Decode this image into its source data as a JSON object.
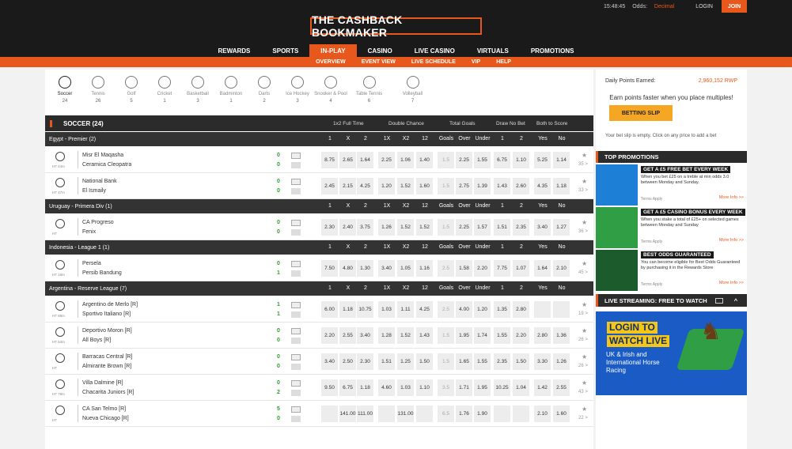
{
  "topbar": {
    "time": "15:48:45",
    "odds_label": "Odds:",
    "odds_value": "Decimal",
    "login": "LOGIN",
    "join": "JOIN"
  },
  "brand": {
    "logo": "THE CASHBACK BOOKMAKER",
    "accent": "#e8581c"
  },
  "nav": [
    "REWARDS",
    "SPORTS",
    "IN-PLAY",
    "CASINO",
    "LIVE CASINO",
    "VIRTUALS",
    "PROMOTIONS"
  ],
  "subnav": [
    "OVERVIEW",
    "EVENT VIEW",
    "LIVE SCHEDULE",
    "VIP",
    "HELP"
  ],
  "sports": [
    {
      "name": "Soccer",
      "count": "24",
      "icon": "soccer-icon"
    },
    {
      "name": "Tennis",
      "count": "26",
      "icon": "tennis-icon"
    },
    {
      "name": "Golf",
      "count": "5",
      "icon": "golf-icon"
    },
    {
      "name": "Cricket",
      "count": "1",
      "icon": "cricket-icon"
    },
    {
      "name": "Basketball",
      "count": "3",
      "icon": "basketball-icon"
    },
    {
      "name": "Badminton",
      "count": "1",
      "icon": "badminton-icon"
    },
    {
      "name": "Darts",
      "count": "2",
      "icon": "darts-icon"
    },
    {
      "name": "Ice Hockey",
      "count": "3",
      "icon": "ice-hockey-icon"
    },
    {
      "name": "Snooker & Pool",
      "count": "4",
      "icon": "snooker-icon"
    },
    {
      "name": "Table Tennis",
      "count": "6",
      "icon": "table-tennis-icon"
    },
    {
      "name": "Volleyball",
      "count": "7",
      "icon": "volleyball-icon"
    }
  ],
  "section": {
    "title": "SOCCER (24)",
    "groups": [
      "1x2 Full Time",
      "Double Chance",
      "Total Goals",
      "Draw No Bet",
      "Both to Score"
    ]
  },
  "market_cols": [
    "1",
    "X",
    "2",
    "1X",
    "X2",
    "12",
    "Goals",
    "Over",
    "Under",
    "1",
    "2",
    "Yes",
    "No"
  ],
  "leagues": [
    {
      "name": "Egypt - Premier (2)",
      "matches": [
        {
          "time": "HT 44m",
          "home": "Misr El Maqasha",
          "away": "Ceramica Cleopatra",
          "s1": "0",
          "s2": "0",
          "odds": [
            "8.75",
            "2.65",
            "1.64",
            "2.25",
            "1.06",
            "1.40",
            "1.5",
            "2.25",
            "1.55",
            "6.75",
            "1.10",
            "5.25",
            "1.14"
          ],
          "more": "35"
        },
        {
          "time": "HT 47m",
          "home": "National Bank",
          "away": "El Ismaily",
          "s1": "0",
          "s2": "0",
          "odds": [
            "2.45",
            "2.15",
            "4.25",
            "1.20",
            "1.52",
            "1.60",
            "1.5",
            "2.75",
            "1.39",
            "1.43",
            "2.60",
            "4.35",
            "1.18"
          ],
          "more": "33"
        }
      ]
    },
    {
      "name": "Uruguay - Primera Div (1)",
      "matches": [
        {
          "time": "HT",
          "home": "CA Progreso",
          "away": "Fenix",
          "s1": "0",
          "s2": "0",
          "odds": [
            "2.30",
            "2.40",
            "3.75",
            "1.26",
            "1.52",
            "1.52",
            "1.5",
            "2.25",
            "1.57",
            "1.51",
            "2.35",
            "3.40",
            "1.27"
          ],
          "more": "36"
        }
      ]
    },
    {
      "name": "Indonesia - League 1 (1)",
      "matches": [
        {
          "time": "HT 18m",
          "home": "Persela",
          "away": "Persib Bandung",
          "s1": "0",
          "s2": "1",
          "odds": [
            "7.50",
            "4.80",
            "1.30",
            "3.40",
            "1.05",
            "1.16",
            "2.5",
            "1.58",
            "2.20",
            "7.75",
            "1.07",
            "1.64",
            "2.10"
          ],
          "more": "45"
        }
      ]
    },
    {
      "name": "Argentina - Reserve League (7)",
      "matches": [
        {
          "time": "HT 88m",
          "home": "Argentino de Merlo [R]",
          "away": "Sportivo Italiano [R]",
          "s1": "1",
          "s2": "1",
          "odds": [
            "6.00",
            "1.18",
            "10.75",
            "1.03",
            "1.11",
            "4.25",
            "2.5",
            "4.00",
            "1.20",
            "1.35",
            "2.80",
            "",
            ""
          ],
          "more": "19"
        },
        {
          "time": "HT 54m",
          "home": "Deportivo Moron [R]",
          "away": "All Boys [R]",
          "s1": "0",
          "s2": "0",
          "odds": [
            "2.20",
            "2.55",
            "3.40",
            "1.28",
            "1.52",
            "1.43",
            "1.5",
            "1.95",
            "1.74",
            "1.55",
            "2.20",
            "2.80",
            "1.36"
          ],
          "more": "26"
        },
        {
          "time": "HT",
          "home": "Barracas Central [R]",
          "away": "Almirante Brown [R]",
          "s1": "0",
          "s2": "0",
          "odds": [
            "3.40",
            "2.50",
            "2.30",
            "1.51",
            "1.25",
            "1.50",
            "1.5",
            "1.65",
            "1.55",
            "2.35",
            "1.50",
            "3.30",
            "1.26"
          ],
          "more": "26"
        },
        {
          "time": "HT 78m",
          "home": "Villa Dalmine [R]",
          "away": "Chacarita Juniors [R]",
          "s1": "0",
          "s2": "2",
          "odds": [
            "9.50",
            "6.75",
            "1.18",
            "4.60",
            "1.03",
            "1.10",
            "3.5",
            "1.71",
            "1.95",
            "10.25",
            "1.04",
            "1.42",
            "2.55"
          ],
          "more": "43"
        },
        {
          "time": "HT",
          "home": "CA San Telmo [R]",
          "away": "Nueva Chicago [R]",
          "s1": "5",
          "s2": "0",
          "odds": [
            "",
            "141.00",
            "111.00",
            "",
            "131.00",
            "",
            "6.5",
            "1.76",
            "1.90",
            "",
            "",
            "2.10",
            "1.60"
          ],
          "more": "22"
        }
      ]
    }
  ],
  "sidebar": {
    "daily_label": "Daily Points Earned:",
    "daily_value": "2,960,152 RWP",
    "earn_text": "Earn points faster when you place multiples!",
    "betslip": "BETTING SLIP",
    "empty": "Your bet slip is empty. Click on any price to add a bet",
    "promos_title": "TOP PROMOTIONS",
    "promos": [
      {
        "title": "GET A £5 FREE BET EVERY WEEK",
        "desc": "When you bet £25 on a treble at min odds 3.0 between Monday and Sunday.",
        "terms": "Terms Apply",
        "more": "More Info >>",
        "bg": "#1e7fd6"
      },
      {
        "title": "GET A £5 CASINO BONUS EVERY WEEK",
        "desc": "When you stake a total of £25+ on selected games between Monday and Sunday",
        "terms": "Terms Apply",
        "more": "More Info >>",
        "bg": "#2f9e44"
      },
      {
        "title": "BEST ODDS GUARANTEED",
        "desc": "You can become eligible for Best Odds Guaranteed by purchasing it in the Rewards Store",
        "terms": "Terms Apply",
        "more": "More Info >>",
        "bg": "#1c5b2c"
      }
    ],
    "live_title": "LIVE STREAMING: FREE TO WATCH",
    "live_a": "LOGIN TO",
    "live_b": "WATCH LIVE",
    "live_c": "UK & Irish and International Horse Racing"
  }
}
